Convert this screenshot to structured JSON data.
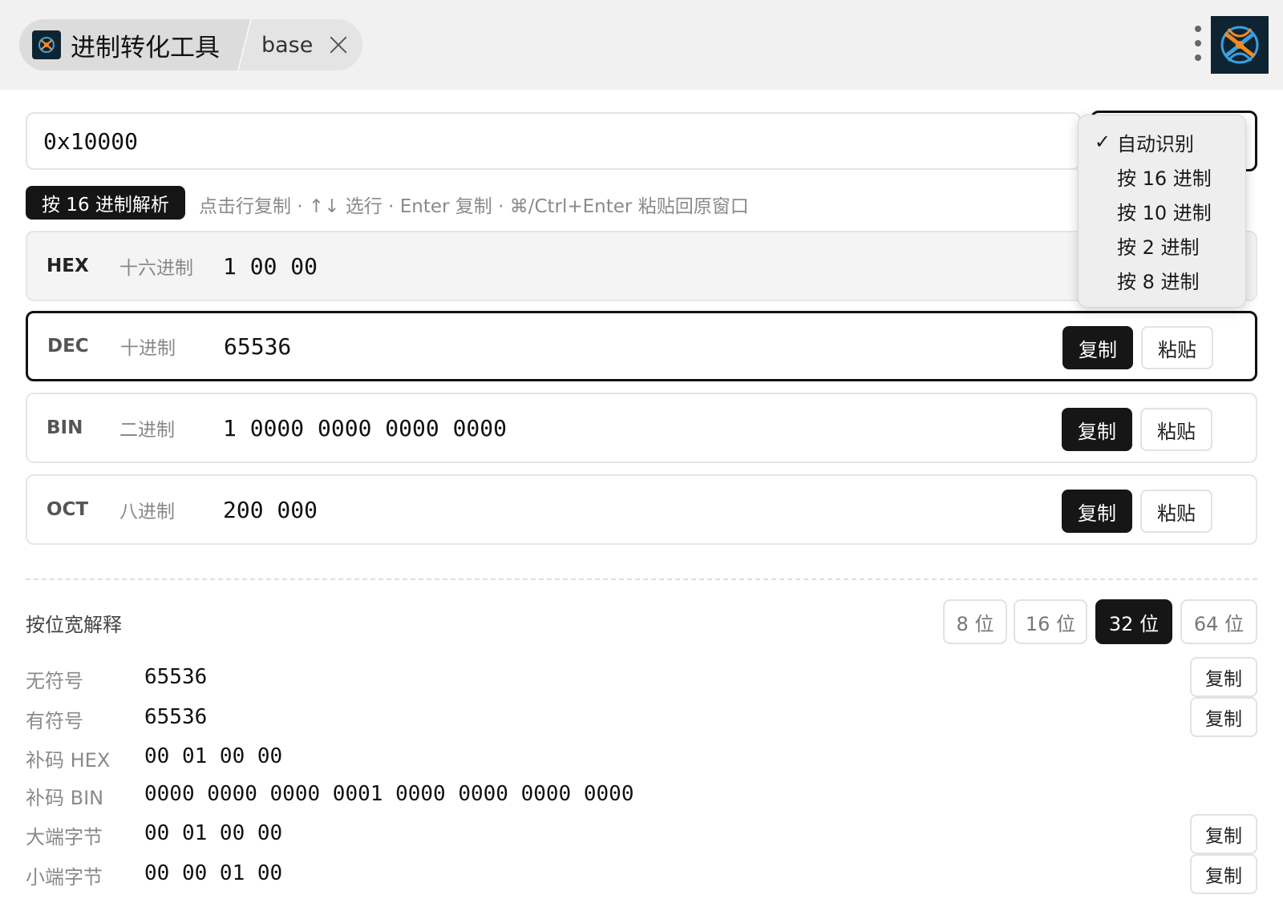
{
  "header": {
    "tab_title": "进制转化工具",
    "tab_sub": "base"
  },
  "input": {
    "value": "0x10000"
  },
  "badge": "按 16 进制解析",
  "hint": "点击行复制 · ↑↓ 选行 · Enter 复制 · ⌘/Ctrl+Enter 粘贴回原窗口",
  "rows": [
    {
      "code": "HEX",
      "name": "十六进制",
      "value": "1 00 00"
    },
    {
      "code": "DEC",
      "name": "十进制",
      "value": "65536"
    },
    {
      "code": "BIN",
      "name": "二进制",
      "value": "1 0000 0000 0000 0000"
    },
    {
      "code": "OCT",
      "name": "八进制",
      "value": "200 000"
    }
  ],
  "buttons": {
    "copy": "复制",
    "paste": "粘贴"
  },
  "bitwidth": {
    "label": "按位宽解释",
    "options": [
      "8 位",
      "16 位",
      "32 位",
      "64 位"
    ],
    "selected": "32 位"
  },
  "details": [
    {
      "key": "无符号",
      "value": "65536"
    },
    {
      "key": "有符号",
      "value": "65536"
    },
    {
      "key": "补码 HEX",
      "value": "00 01 00 00"
    },
    {
      "key": "补码 BIN",
      "value": "0000 0000 0000 0001 0000 0000 0000 0000"
    },
    {
      "key": "大端字节",
      "value": "00 01 00 00"
    },
    {
      "key": "小端字节",
      "value": "00 00 01 00"
    }
  ],
  "menu": {
    "items": [
      "自动识别",
      "按 16 进制",
      "按 10 进制",
      "按 2 进制",
      "按 8 进制"
    ],
    "checked": "自动识别",
    "check_mark": "✓"
  },
  "colors": {
    "accent_dark": "#161616",
    "logo_bg": "#0f2433",
    "logo_orange": "#f08a24",
    "logo_blue": "#3aa0e0"
  }
}
